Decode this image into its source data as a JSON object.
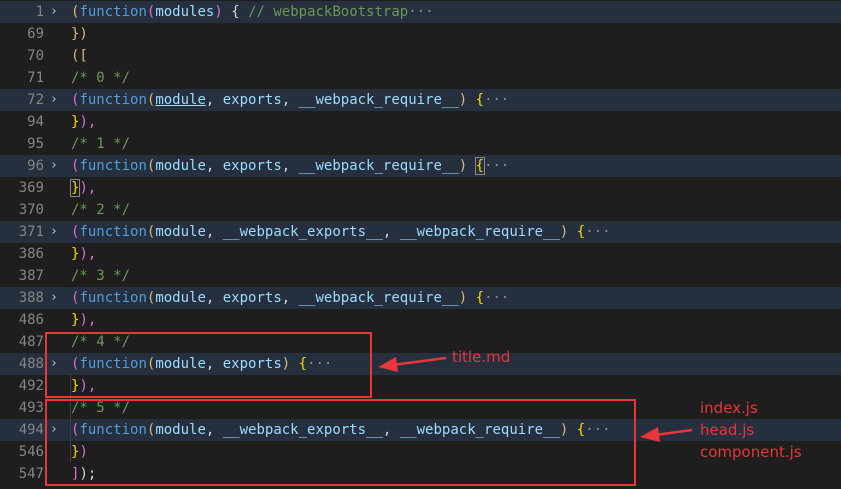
{
  "lines": [
    {
      "num": "1",
      "folded": true,
      "fold": "›",
      "tokens": [
        [
          "(",
          "t-paren"
        ],
        [
          "function",
          "t-kw"
        ],
        [
          "(",
          "t-bracket"
        ],
        [
          "modules",
          "t-param"
        ],
        [
          ")",
          "t-bracket"
        ],
        [
          " { ",
          "t-punct"
        ],
        [
          "// webpackBootstrap",
          "t-comment"
        ],
        [
          "···",
          "t-ellipsis"
        ]
      ]
    },
    {
      "num": "69",
      "folded": false,
      "fold": "",
      "tokens": [
        [
          "})",
          "t-paren"
        ]
      ]
    },
    {
      "num": "70",
      "folded": false,
      "fold": "",
      "tokens": [
        [
          "([",
          "t-paren"
        ]
      ]
    },
    {
      "num": "71",
      "folded": false,
      "fold": "",
      "tokens": [
        [
          "/* 0 */",
          "t-comment"
        ]
      ]
    },
    {
      "num": "72",
      "folded": true,
      "fold": "›",
      "tokens": [
        [
          "(",
          "t-bracket"
        ],
        [
          "function",
          "t-kw"
        ],
        [
          "(",
          "t-paren"
        ],
        [
          "module",
          "t-param t-under"
        ],
        [
          ", ",
          "t-punct"
        ],
        [
          "exports",
          "t-param"
        ],
        [
          ", ",
          "t-punct"
        ],
        [
          "__webpack_require__",
          "t-param"
        ],
        [
          ") ",
          "t-paren"
        ],
        [
          "{",
          "t-brace"
        ],
        [
          "···",
          "t-ellipsis"
        ]
      ]
    },
    {
      "num": "94",
      "folded": false,
      "fold": "",
      "tokens": [
        [
          "}",
          "t-brace"
        ],
        [
          "),",
          "t-bracket"
        ]
      ]
    },
    {
      "num": "95",
      "folded": false,
      "fold": "",
      "tokens": [
        [
          "/* 1 */",
          "t-comment"
        ]
      ]
    },
    {
      "num": "96",
      "folded": true,
      "fold": "›",
      "tokens": [
        [
          "(",
          "t-bracket"
        ],
        [
          "function",
          "t-kw"
        ],
        [
          "(",
          "t-paren"
        ],
        [
          "module",
          "t-param"
        ],
        [
          ", ",
          "t-punct"
        ],
        [
          "exports",
          "t-param"
        ],
        [
          ", ",
          "t-punct"
        ],
        [
          "__webpack_require__",
          "t-param"
        ],
        [
          ") ",
          "t-paren"
        ],
        [
          "{",
          "t-brace t-match"
        ],
        [
          "···",
          "t-ellipsis"
        ]
      ]
    },
    {
      "num": "369",
      "folded": false,
      "fold": "",
      "tokens": [
        [
          "}",
          "t-brace t-match"
        ],
        [
          "),",
          "t-bracket"
        ]
      ]
    },
    {
      "num": "370",
      "folded": false,
      "fold": "",
      "tokens": [
        [
          "/* 2 */",
          "t-comment"
        ]
      ]
    },
    {
      "num": "371",
      "folded": true,
      "fold": "›",
      "tokens": [
        [
          "(",
          "t-bracket"
        ],
        [
          "function",
          "t-kw"
        ],
        [
          "(",
          "t-paren"
        ],
        [
          "module",
          "t-param"
        ],
        [
          ", ",
          "t-punct"
        ],
        [
          "__webpack_exports__",
          "t-param"
        ],
        [
          ", ",
          "t-punct"
        ],
        [
          "__webpack_require__",
          "t-param"
        ],
        [
          ") ",
          "t-paren"
        ],
        [
          "{",
          "t-brace"
        ],
        [
          "···",
          "t-ellipsis"
        ]
      ]
    },
    {
      "num": "386",
      "folded": false,
      "fold": "",
      "tokens": [
        [
          "}",
          "t-brace"
        ],
        [
          "),",
          "t-bracket"
        ]
      ]
    },
    {
      "num": "387",
      "folded": false,
      "fold": "",
      "tokens": [
        [
          "/* 3 */",
          "t-comment"
        ]
      ]
    },
    {
      "num": "388",
      "folded": true,
      "fold": "›",
      "tokens": [
        [
          "(",
          "t-bracket"
        ],
        [
          "function",
          "t-kw"
        ],
        [
          "(",
          "t-paren"
        ],
        [
          "module",
          "t-param"
        ],
        [
          ", ",
          "t-punct"
        ],
        [
          "exports",
          "t-param"
        ],
        [
          ", ",
          "t-punct"
        ],
        [
          "__webpack_require__",
          "t-param"
        ],
        [
          ") ",
          "t-paren"
        ],
        [
          "{",
          "t-brace"
        ],
        [
          "···",
          "t-ellipsis"
        ]
      ]
    },
    {
      "num": "486",
      "folded": false,
      "fold": "",
      "tokens": [
        [
          "}",
          "t-brace"
        ],
        [
          "),",
          "t-bracket"
        ]
      ]
    },
    {
      "num": "487",
      "folded": false,
      "fold": "",
      "tokens": [
        [
          "/* 4 */",
          "t-comment"
        ]
      ]
    },
    {
      "num": "488",
      "folded": true,
      "fold": "›",
      "tokens": [
        [
          "(",
          "t-bracket"
        ],
        [
          "function",
          "t-kw"
        ],
        [
          "(",
          "t-paren"
        ],
        [
          "module",
          "t-param"
        ],
        [
          ", ",
          "t-punct"
        ],
        [
          "exports",
          "t-param"
        ],
        [
          ") ",
          "t-paren"
        ],
        [
          "{",
          "t-brace"
        ],
        [
          "···",
          "t-ellipsis"
        ]
      ]
    },
    {
      "num": "492",
      "folded": false,
      "fold": "",
      "tokens": [
        [
          "}",
          "t-brace"
        ],
        [
          "),",
          "t-bracket"
        ]
      ]
    },
    {
      "num": "493",
      "folded": false,
      "fold": "",
      "tokens": [
        [
          "/* 5 */",
          "t-comment"
        ]
      ]
    },
    {
      "num": "494",
      "folded": true,
      "fold": "›",
      "tokens": [
        [
          "(",
          "t-bracket"
        ],
        [
          "function",
          "t-kw"
        ],
        [
          "(",
          "t-paren"
        ],
        [
          "module",
          "t-param"
        ],
        [
          ", ",
          "t-punct"
        ],
        [
          "__webpack_exports__",
          "t-param"
        ],
        [
          ", ",
          "t-punct"
        ],
        [
          "__webpack_require__",
          "t-param"
        ],
        [
          ") ",
          "t-paren"
        ],
        [
          "{",
          "t-brace"
        ],
        [
          "···",
          "t-ellipsis"
        ]
      ]
    },
    {
      "num": "546",
      "folded": false,
      "fold": "",
      "tokens": [
        [
          "}",
          "t-brace"
        ],
        [
          ")",
          "t-bracket"
        ]
      ]
    },
    {
      "num": "547",
      "folded": false,
      "fold": "",
      "tokens": [
        [
          "]",
          "t-bracket"
        ],
        [
          ");",
          "t-punct"
        ]
      ]
    }
  ],
  "annotations": {
    "title_label": "title.md",
    "files_label_1": "index.js",
    "files_label_2": "head.js",
    "files_label_3": "component.js"
  },
  "colors": {
    "highlight_red": "#e8363a",
    "folded_line_bg": "#252f3d",
    "editor_bg": "#1e1e1e"
  }
}
